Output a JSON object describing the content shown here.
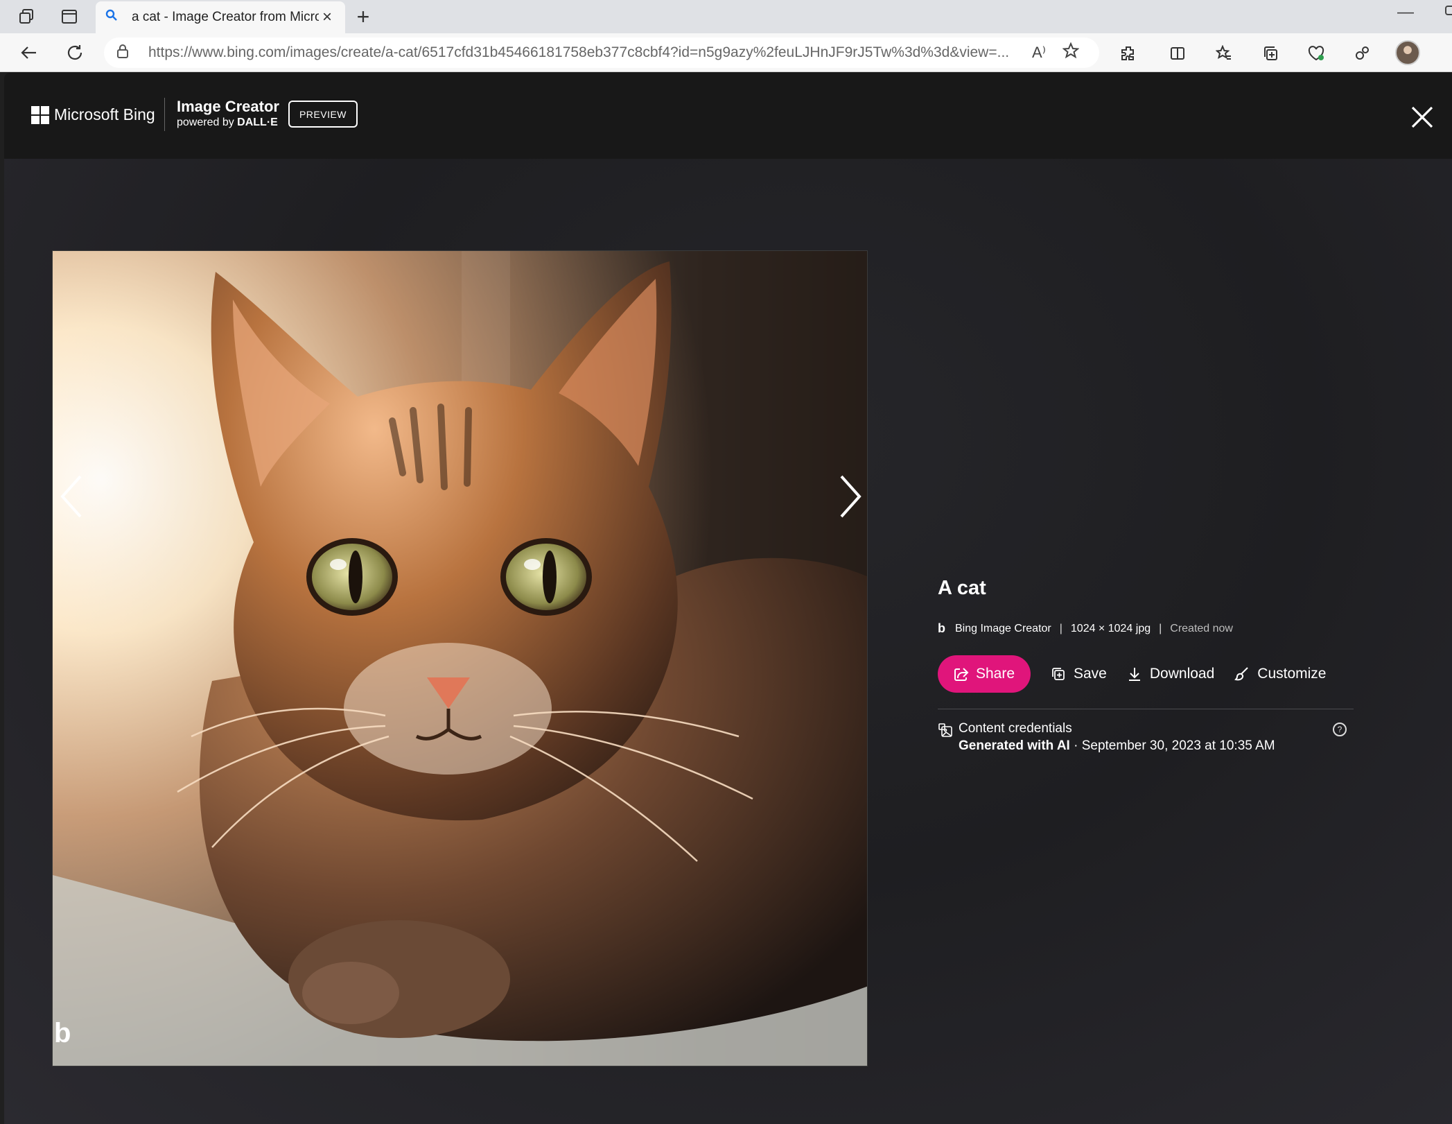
{
  "browser": {
    "tab_title": "a cat - Image Creator from Micro",
    "url": "https://www.bing.com/images/create/a-cat/6517cfd31b45466181758eb377c8cbf4?id=n5g9azy%2feuLJHnJF9rJ5Tw%3d%3d&view=...",
    "read_aloud_label": "A⁾"
  },
  "header": {
    "brand": "Microsoft Bing",
    "product_title": "Image Creator",
    "powered_by": "powered by",
    "powered_by_engine": "DALL·E",
    "preview_badge": "PREVIEW"
  },
  "image": {
    "watermark": "b"
  },
  "details": {
    "title": "A cat",
    "source": "Bing Image Creator",
    "dimensions": "1024 × 1024 jpg",
    "created": "Created now",
    "separator": "|",
    "actions": {
      "share": "Share",
      "save": "Save",
      "download": "Download",
      "customize": "Customize"
    },
    "credentials": {
      "title": "Content credentials",
      "generated": "Generated with AI",
      "date": " · September 30, 2023 at 10:35 AM"
    }
  },
  "colors": {
    "accent": "#e0157b",
    "header_bg": "#181818",
    "page_bg": "#1e1e21",
    "chrome_bg": "#f7f7f7"
  }
}
